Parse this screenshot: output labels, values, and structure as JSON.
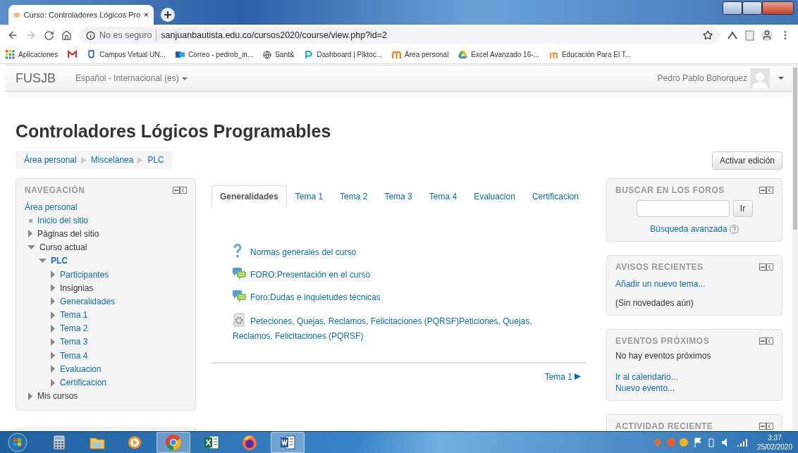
{
  "browser": {
    "tab_title": "Curso: Controladores Lógicos Pro",
    "security": "No es seguro",
    "url": "sanjuanbautista.edu.co/cursos2020/course/view.php?id=2",
    "bookmarks": [
      {
        "kind": "apps",
        "label": "Aplicaciones"
      },
      {
        "kind": "mail"
      },
      {
        "kind": "campus",
        "label": "Campus Virtual UN..."
      },
      {
        "kind": "outlook",
        "label": "Correo - pedrob_in..."
      },
      {
        "kind": "globe",
        "label": "Sant&"
      },
      {
        "kind": "piktochart",
        "label": "Dashboard | Piktoc..."
      },
      {
        "kind": "moodle",
        "label": "Área personal"
      },
      {
        "kind": "drive",
        "label": "Excel Avanzado 16-..."
      },
      {
        "kind": "moodle-small",
        "label": "Educación Para El T..."
      }
    ]
  },
  "navbar": {
    "brand": "FUSJB",
    "language": "Español - Internacional (es)",
    "user": "Pedro Pablo Bohorquez"
  },
  "page_title": "Controladores Lógicos Programables",
  "breadcrumb": [
    "Área personal",
    "Miscelánea",
    "PLC"
  ],
  "edit_button": "Activar edición",
  "navigation": {
    "title": "NAVEGACIÓN",
    "items": [
      {
        "label": "Área personal",
        "kind": "root",
        "link": true
      },
      {
        "label": "Inicio del sitio",
        "kind": "page",
        "link": true
      },
      {
        "label": "Páginas del sitio",
        "kind": "branch",
        "link": false,
        "expanded": false
      },
      {
        "label": "Curso actual",
        "kind": "branch",
        "link": false,
        "expanded": true,
        "children": [
          {
            "label": "PLC",
            "kind": "course",
            "link": true,
            "expanded": true,
            "children": [
              {
                "label": "Participantes",
                "kind": "branch",
                "link": true,
                "expanded": false
              },
              {
                "label": "Insignias",
                "kind": "branch",
                "link": false,
                "expanded": false
              },
              {
                "label": "Generalidades",
                "kind": "branch",
                "link": true,
                "expanded": false
              },
              {
                "label": "Tema 1",
                "kind": "branch",
                "link": true,
                "expanded": false
              },
              {
                "label": "Tema 2",
                "kind": "branch",
                "link": true,
                "expanded": false
              },
              {
                "label": "Tema 3",
                "kind": "branch",
                "link": true,
                "expanded": false
              },
              {
                "label": "Tema 4",
                "kind": "branch",
                "link": true,
                "expanded": false
              },
              {
                "label": "Evaluacion",
                "kind": "branch",
                "link": true,
                "expanded": false
              },
              {
                "label": "Certificacion",
                "kind": "branch",
                "link": true,
                "expanded": false
              }
            ]
          }
        ]
      },
      {
        "label": "Mis cursos",
        "kind": "branch",
        "link": false,
        "expanded": false
      }
    ]
  },
  "tabs": [
    {
      "label": "Generalidades",
      "selected": true
    },
    {
      "label": "Tema 1",
      "selected": false
    },
    {
      "label": "Tema 2",
      "selected": false
    },
    {
      "label": "Tema 3",
      "selected": false
    },
    {
      "label": "Tema 4",
      "selected": false
    },
    {
      "label": "Evaluacion",
      "selected": false
    },
    {
      "label": "Certificacion",
      "selected": false
    }
  ],
  "activities": [
    {
      "kind": "help",
      "text": "Normas generales del curso"
    },
    {
      "kind": "forum",
      "text": "FORO:Presentación en el curso"
    },
    {
      "kind": "forum",
      "text": "Foro:Dudas e inquietudes técnicas"
    },
    {
      "kind": "feedback",
      "text": "Peteciones, Quejas, Reclamos, Felicitaciones (PQRSF)Peticiones, Quejas, Reclamos, Felicitaciones (PQRSF)"
    }
  ],
  "next_link": "Tema 1",
  "search_block": {
    "title": "BUSCAR EN LOS FOROS",
    "button": "Ir",
    "advanced": "Búsqueda avanzada"
  },
  "news_block": {
    "title": "AVISOS RECIENTES",
    "add": "Añadir un nuevo tema...",
    "empty": "(Sin novedades aún)"
  },
  "events_block": {
    "title": "EVENTOS PRÓXIMOS",
    "empty": "No hay eventos próximos",
    "links": [
      "Ir al calendario...",
      "Nuevo evento..."
    ]
  },
  "activity_block": {
    "title": "ACTIVIDAD RECIENTE"
  },
  "taskbar": {
    "apps": [
      {
        "kind": "calculator",
        "active": false
      },
      {
        "kind": "explorer",
        "active": false
      },
      {
        "kind": "media",
        "active": false
      },
      {
        "kind": "chrome",
        "active": true
      },
      {
        "kind": "excel",
        "active": false
      },
      {
        "kind": "firefox",
        "active": false
      },
      {
        "kind": "word",
        "active": true
      }
    ],
    "time": "3:37",
    "date": "25/02/2020"
  }
}
